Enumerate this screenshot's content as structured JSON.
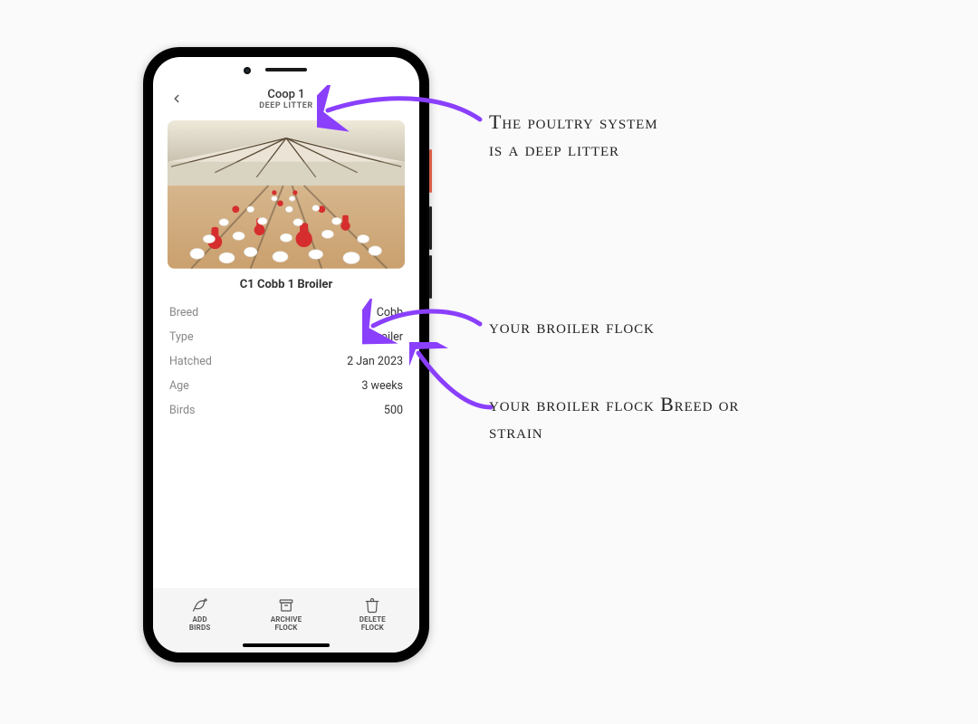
{
  "header": {
    "title": "Coop 1",
    "subtitle": "DEEP LITTER"
  },
  "flock": {
    "name": "C1 Cobb 1 Broiler",
    "details": {
      "breed_label": "Breed",
      "breed_value": "Cobb",
      "type_label": "Type",
      "type_value": "Broiler",
      "hatched_label": "Hatched",
      "hatched_value": "2 Jan 2023",
      "age_label": "Age",
      "age_value": "3 weeks",
      "birds_label": "Birds",
      "birds_value": "500"
    }
  },
  "actions": {
    "add_line1": "ADD",
    "add_line2": "BIRDS",
    "archive_line1": "ARCHIVE",
    "archive_line2": "FLOCK",
    "delete_line1": "DELETE",
    "delete_line2": "FLOCK"
  },
  "annotations": {
    "a1_line1": "The poultry system",
    "a1_line2": "is a deep litter",
    "a2": "your broiler flock",
    "a3_line1": "your broiler flock Breed or",
    "a3_line2": "strain"
  },
  "colors": {
    "arrow": "#8a3ffc"
  }
}
